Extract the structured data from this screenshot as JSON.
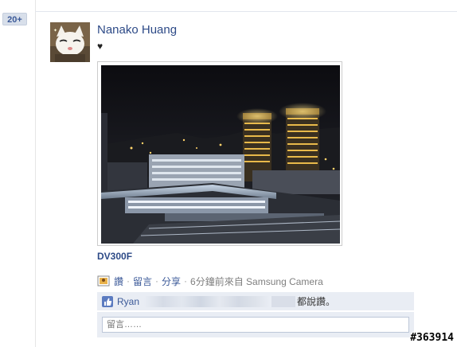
{
  "sidebar": {
    "count_badge": "20+"
  },
  "post": {
    "author": "Nanako Huang",
    "message": "♥",
    "photo_caption": "DV300F",
    "meta": {
      "like_link": "讚",
      "comment_link": "留言",
      "share_link": "分享",
      "separator": "·",
      "time_source": "6分鐘前來自 Samsung Camera"
    },
    "likes": {
      "first_name": "Ryan",
      "suffix": "都說讚。"
    },
    "comment_placeholder": "留言……"
  },
  "watermark": "#363914",
  "colors": {
    "link": "#3b5998",
    "bar": "#e9edf4"
  }
}
